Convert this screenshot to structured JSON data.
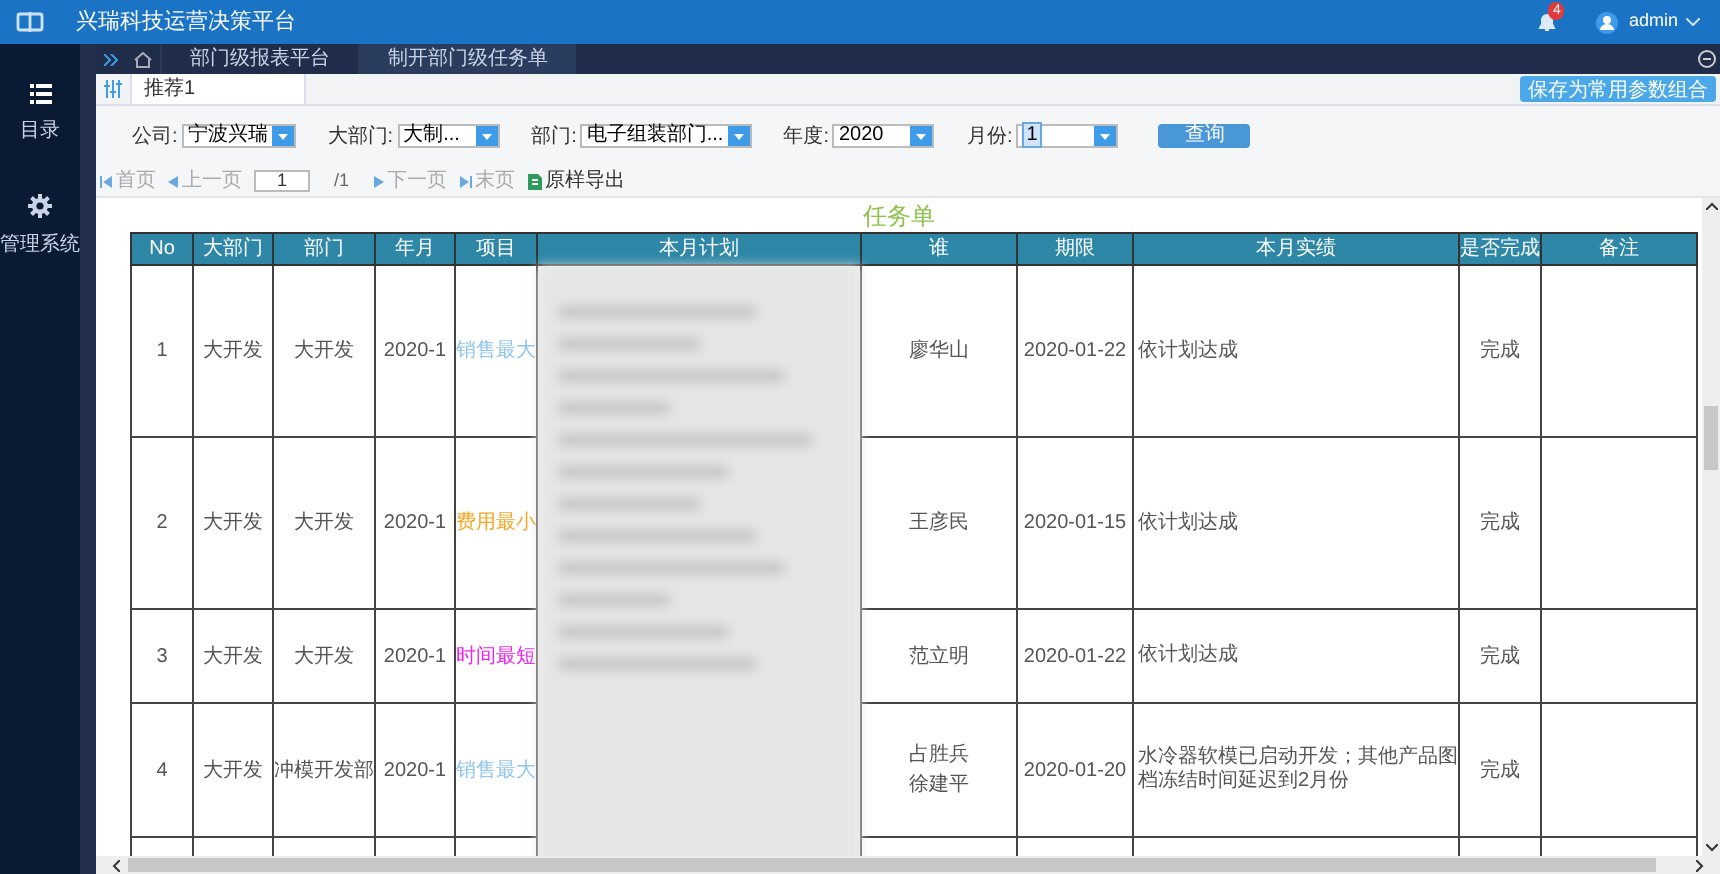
{
  "header": {
    "title": "兴瑞科技运营决策平台",
    "notifications": "4",
    "user": "admin"
  },
  "sidebar": {
    "items": [
      {
        "label": "目录",
        "kind": "list"
      },
      {
        "label": "管理系统",
        "kind": "gear"
      }
    ]
  },
  "tabs": [
    {
      "label": "部门级报表平台",
      "selected": false
    },
    {
      "label": "制开部门级任务单",
      "selected": true
    }
  ],
  "param_tab": {
    "label": "推荐1"
  },
  "save_button": "保存为常用参数组合",
  "filters": [
    {
      "label": "公司:",
      "value": "宁波兴瑞",
      "highlighted": false
    },
    {
      "label": "大部门:",
      "value": "大制...",
      "highlighted": false
    },
    {
      "label": "部门:",
      "value": "电子组装部门...",
      "highlighted": false
    },
    {
      "label": "年度:",
      "value": "2020",
      "highlighted": false
    },
    {
      "label": "月份:",
      "value": "1",
      "highlighted": true
    }
  ],
  "query_button": "查询",
  "pager": {
    "first": "首页",
    "prev": "上一页",
    "page": "1",
    "total": "/1",
    "next": "下一页",
    "last": "末页",
    "export": "原样导出"
  },
  "report": {
    "title": "任务单",
    "columns": [
      "No",
      "大部门",
      "部门",
      "年月",
      "项目",
      "本月计划",
      "谁",
      "期限",
      "本月实绩",
      "是否完成",
      "备注"
    ],
    "rows": [
      {
        "no": "1",
        "division": "大开发",
        "department": "大开发",
        "month": "2020-1",
        "project": "销售最大",
        "color": "#8ec5f0",
        "owners": [
          "廖华山"
        ],
        "deadline": "2020-01-22",
        "result": "依计划达成",
        "done": "完成"
      },
      {
        "no": "2",
        "division": "大开发",
        "department": "大开发",
        "month": "2020-1",
        "project": "费用最小",
        "color": "#f5a623",
        "owners": [
          "王彦民"
        ],
        "deadline": "2020-01-15",
        "result": "依计划达成",
        "done": "完成"
      },
      {
        "no": "3",
        "division": "大开发",
        "department": "大开发",
        "month": "2020-1",
        "project": "时间最短",
        "color": "#ee22ee",
        "owners": [
          "范立明"
        ],
        "deadline": "2020-01-22",
        "result": "依计划达成",
        "done": "完成"
      },
      {
        "no": "4",
        "division": "大开发",
        "department": "冲模开发部",
        "month": "2020-1",
        "project": "销售最大",
        "color": "#8ec5f0",
        "owners": [
          "占胜兵",
          "徐建平"
        ],
        "deadline": "2020-01-20",
        "result": "水冷器软模已启动开发；其他产品图档冻结时间延迟到2月份",
        "done": "完成"
      }
    ]
  }
}
